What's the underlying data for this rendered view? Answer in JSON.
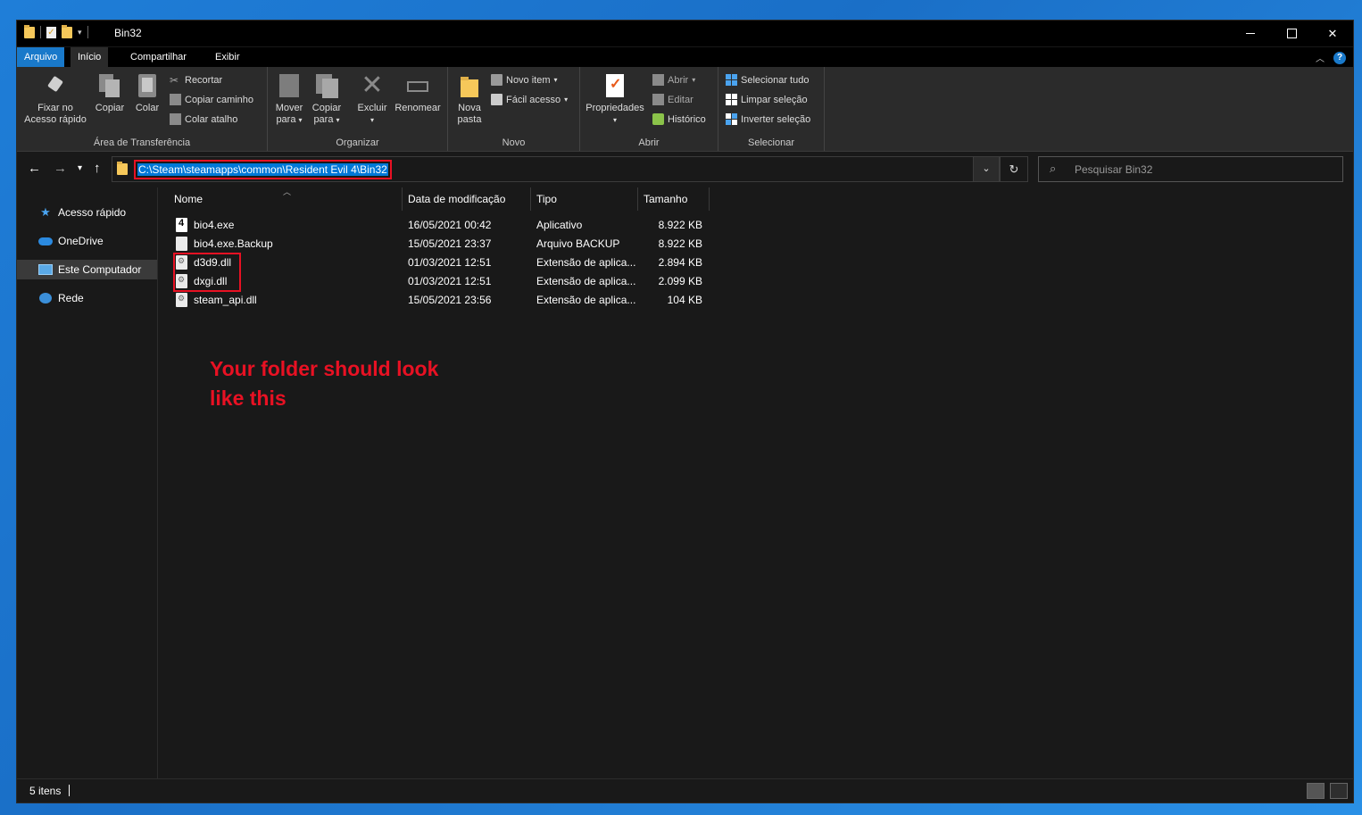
{
  "window": {
    "title": "Bin32",
    "controls": {
      "minimize": "minimize-icon",
      "maximize": "maximize-icon",
      "close": "✕"
    }
  },
  "ribbon_tabs": [
    "Arquivo",
    "Início",
    "Compartilhar",
    "Exibir"
  ],
  "ribbon": {
    "groups": {
      "clipboard": "Área de Transferência",
      "organize": "Organizar",
      "new": "Novo",
      "open": "Abrir",
      "select": "Selecionar"
    },
    "pin_line1": "Fixar no",
    "pin_line2": "Acesso rápido",
    "copy": "Copiar",
    "paste": "Colar",
    "cut": "Recortar",
    "copy_path": "Copiar caminho",
    "paste_shortcut": "Colar atalho",
    "move_line1": "Mover",
    "move_line2": "para",
    "copyto_line1": "Copiar",
    "copyto_line2": "para",
    "delete": "Excluir",
    "rename": "Renomear",
    "newfolder_line1": "Nova",
    "newfolder_line2": "pasta",
    "new_item": "Novo item",
    "easy_access": "Fácil acesso",
    "properties": "Propriedades",
    "open_btn": "Abrir",
    "edit": "Editar",
    "history": "Histórico",
    "select_all": "Selecionar tudo",
    "select_none": "Limpar seleção",
    "invert_select": "Inverter seleção"
  },
  "address": {
    "path": "C:\\Steam\\steamapps\\common\\Resident Evil 4\\Bin32",
    "search_placeholder": "Pesquisar Bin32"
  },
  "sidebar": {
    "items": [
      {
        "label": "Acesso rápido",
        "icon": "star-icon"
      },
      {
        "label": "OneDrive",
        "icon": "cloud-icon"
      },
      {
        "label": "Este Computador",
        "icon": "computer-icon"
      },
      {
        "label": "Rede",
        "icon": "network-icon"
      }
    ]
  },
  "columns": [
    "Nome",
    "Data de modificação",
    "Tipo",
    "Tamanho"
  ],
  "files": [
    {
      "name": "bio4.exe",
      "date": "16/05/2021 00:42",
      "type": "Aplicativo",
      "size": "8.922 KB",
      "icon": "exe-icon"
    },
    {
      "name": "bio4.exe.Backup",
      "date": "15/05/2021 23:37",
      "type": "Arquivo BACKUP",
      "size": "8.922 KB",
      "icon": "file-icon"
    },
    {
      "name": "d3d9.dll",
      "date": "01/03/2021 12:51",
      "type": "Extensão de aplica...",
      "size": "2.894 KB",
      "icon": "dll-icon"
    },
    {
      "name": "dxgi.dll",
      "date": "01/03/2021 12:51",
      "type": "Extensão de aplica...",
      "size": "2.099 KB",
      "icon": "dll-icon"
    },
    {
      "name": "steam_api.dll",
      "date": "15/05/2021 23:56",
      "type": "Extensão de aplica...",
      "size": "104 KB",
      "icon": "dll-icon"
    }
  ],
  "annotation": {
    "line1": "Your folder should look",
    "line2": "like this",
    "color": "#e81123"
  },
  "status": {
    "count": "5 itens"
  },
  "colors": {
    "accent": "#1979ca",
    "selection": "#0078d7",
    "background": "#191919"
  }
}
